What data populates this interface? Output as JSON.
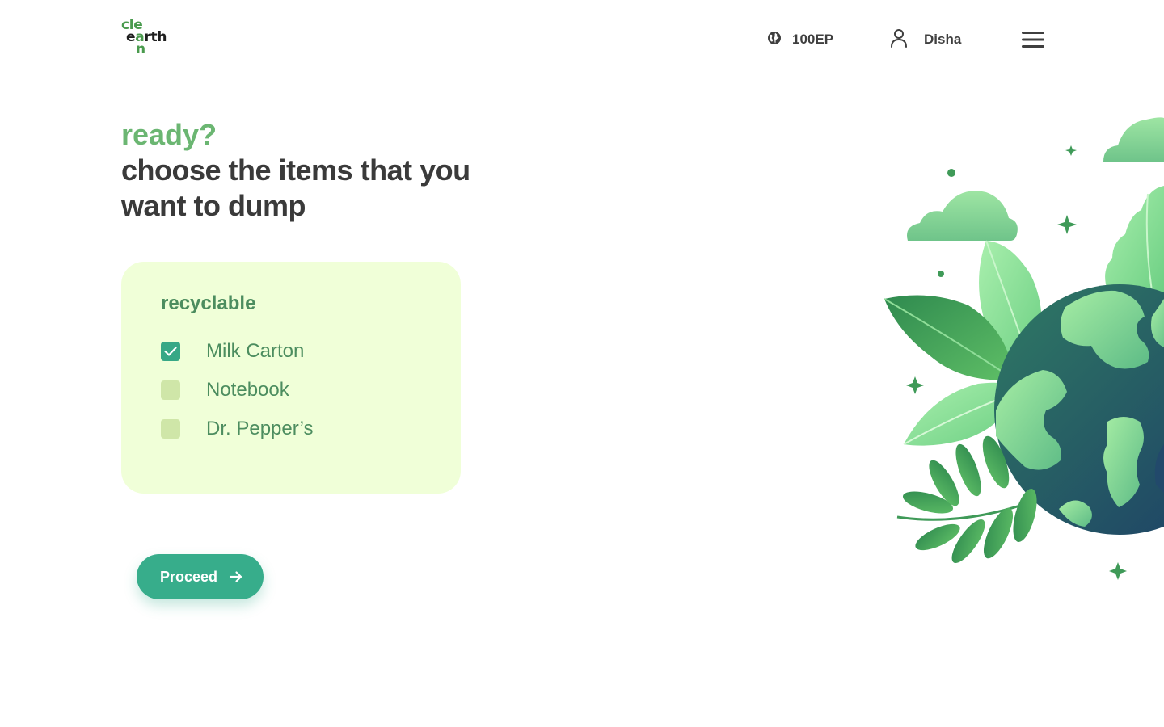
{
  "header": {
    "logo": {
      "line1": "cle",
      "line2_green": "a",
      "line2_pre": "e",
      "line2_post": "rth",
      "line3": "n"
    },
    "points": {
      "icon": "globe-icon",
      "value": "100EP"
    },
    "user": {
      "icon": "user-icon",
      "name": "Disha"
    },
    "menu": {
      "icon": "hamburger-menu-icon"
    }
  },
  "heading": {
    "ready": "ready?",
    "main": "choose the items that you want to dump"
  },
  "card": {
    "title": "recyclable",
    "items": [
      {
        "label": "Milk Carton",
        "checked": true
      },
      {
        "label": "Notebook",
        "checked": false
      },
      {
        "label": "Dr. Pepper’s",
        "checked": false
      }
    ]
  },
  "proceed": {
    "label": "Proceed",
    "icon": "arrow-right-icon"
  },
  "colors": {
    "accent": "#37ad8b",
    "heading_green": "#6bb672",
    "heading_dark": "#3a3a3a",
    "card_bg": "#f0ffd8",
    "item_text": "#4c8d5f"
  }
}
